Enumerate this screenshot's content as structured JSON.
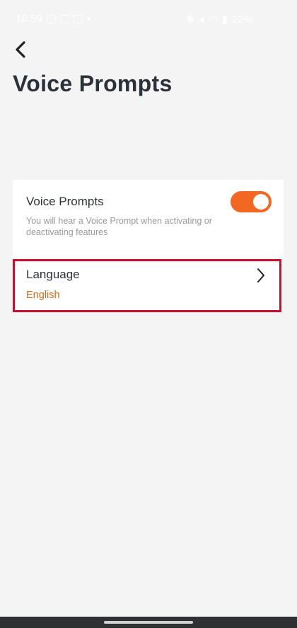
{
  "status_bar": {
    "time": "18:59",
    "battery": "22%"
  },
  "header": {
    "back_icon": "chevron-left-icon",
    "title": "Voice Prompts"
  },
  "voice_prompts": {
    "label": "Voice Prompts",
    "description": "You will hear a Voice Prompt when activating or deactivating features",
    "enabled": true,
    "accent_color": "#f26822"
  },
  "language": {
    "label": "Language",
    "value": "English",
    "value_color": "#d2691e",
    "highlight_color": "#c8102e",
    "chevron_icon": "chevron-right-icon"
  }
}
